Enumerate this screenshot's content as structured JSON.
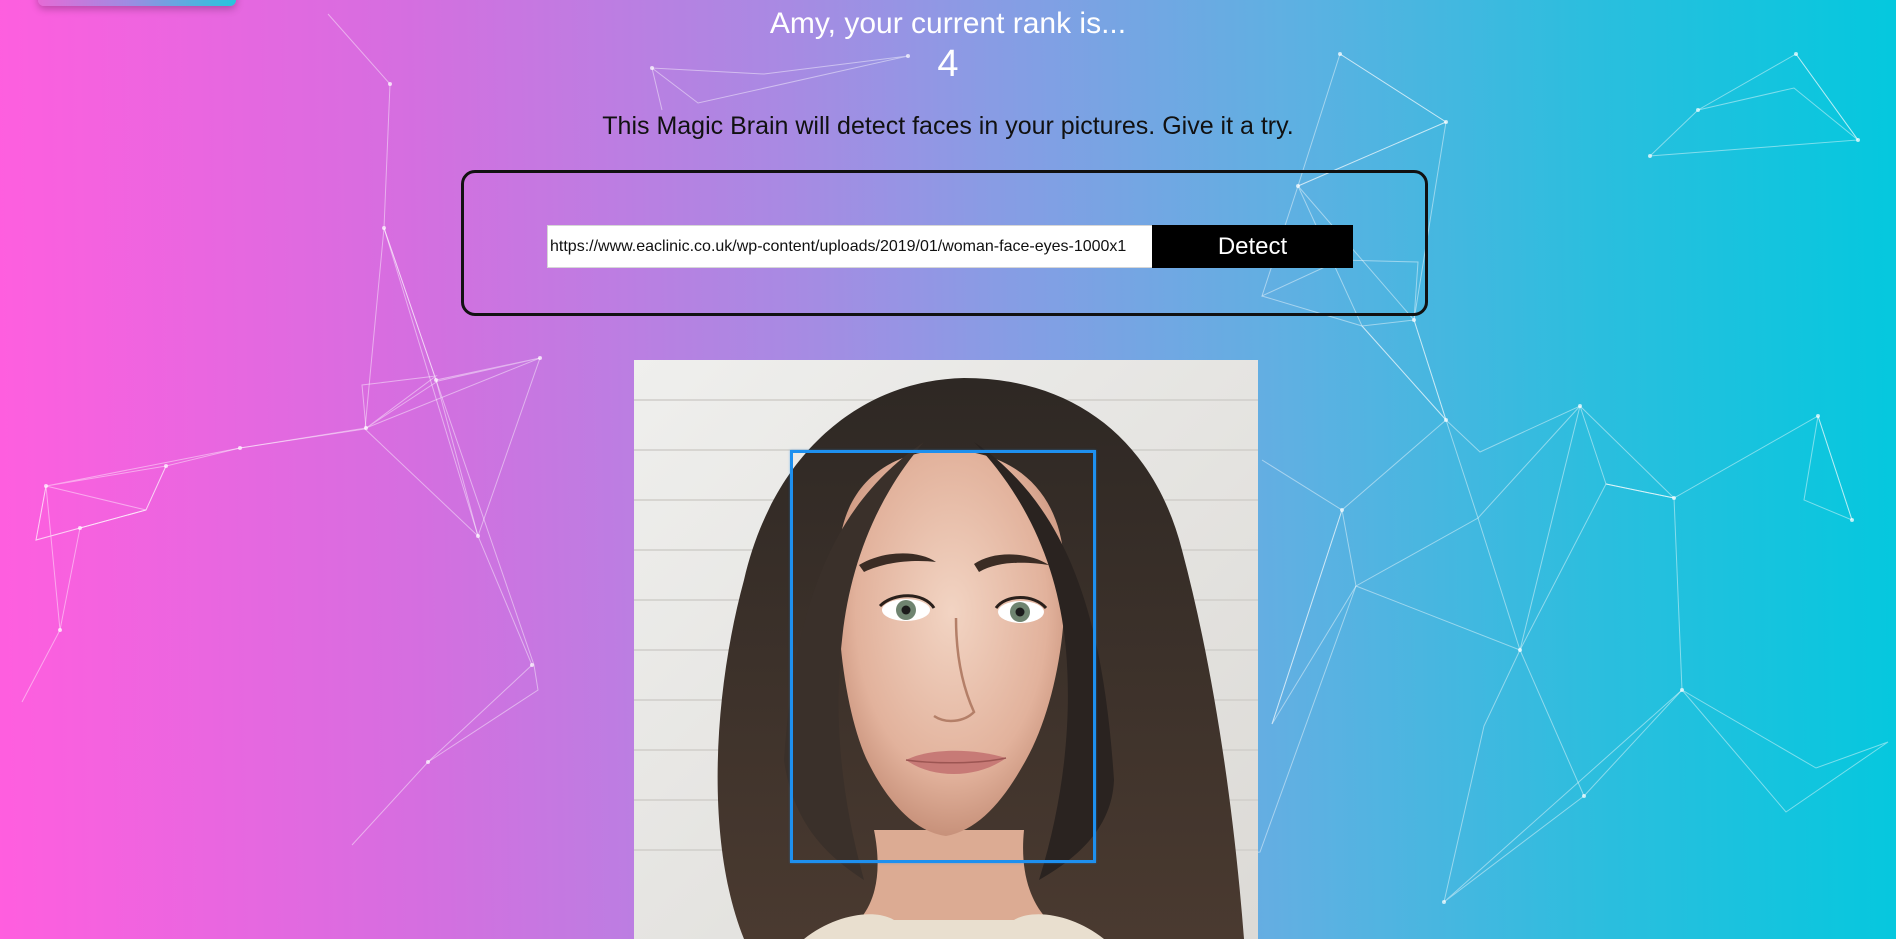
{
  "header": {
    "rank_text": "Amy, your current rank is...",
    "rank_value": "4"
  },
  "description": "This Magic Brain will detect faces in your pictures. Give it a try.",
  "form": {
    "url_value": "https://www.eaclinic.co.uk/wp-content/uploads/2019/01/woman-face-eyes-1000x1",
    "detect_label": "Detect"
  },
  "colors": {
    "gradient_left": "#ff5edf",
    "gradient_right": "#04c8de",
    "face_box": "#1e90ef",
    "button_bg": "#000000"
  },
  "icons": {
    "logo": "brain-logo-tab"
  }
}
